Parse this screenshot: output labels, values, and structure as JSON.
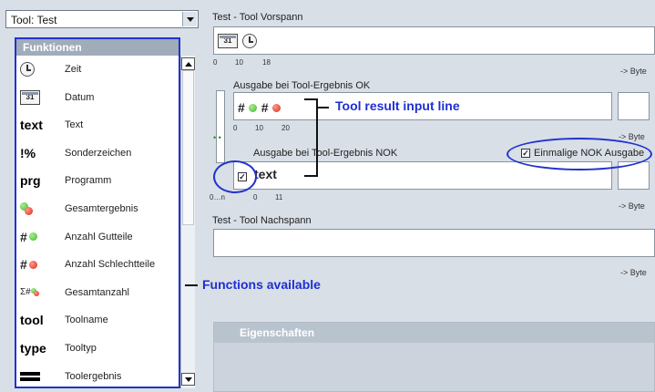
{
  "toolSelect": {
    "value": "Tool: Test"
  },
  "functions": {
    "header": "Funktionen",
    "items": [
      {
        "icon": "clock-icon",
        "glyph": "",
        "label": "Zeit"
      },
      {
        "icon": "calendar-icon",
        "glyph": "31",
        "label": "Datum"
      },
      {
        "icon": "text-icon",
        "glyph": "text",
        "label": "Text"
      },
      {
        "icon": "special-chars-icon",
        "glyph": "!%",
        "label": "Sonderzeichen"
      },
      {
        "icon": "program-icon",
        "glyph": "prg",
        "label": "Programm"
      },
      {
        "icon": "overall-result-icon",
        "glyph": "",
        "label": "Gesamtergebnis"
      },
      {
        "icon": "good-count-icon",
        "glyph": "#",
        "label": "Anzahl Gutteile"
      },
      {
        "icon": "bad-count-icon",
        "glyph": "#",
        "label": "Anzahl Schlechtteile"
      },
      {
        "icon": "total-count-icon",
        "glyph": "Σ#",
        "label": "Gesamtanzahl"
      },
      {
        "icon": "tool-name-icon",
        "glyph": "tool",
        "label": "Toolname"
      },
      {
        "icon": "tool-type-icon",
        "glyph": "type",
        "label": "Tooltyp"
      },
      {
        "icon": "tool-result-icon",
        "glyph": "",
        "label": "Toolergebnis"
      }
    ]
  },
  "preamble": {
    "label": "Test - Tool Vorspann",
    "calendar": "31",
    "ticks": [
      "0",
      "10",
      "18"
    ],
    "unit": "-> Byte"
  },
  "outputOk": {
    "label": "Ausgabe bei Tool-Ergebnis OK",
    "ticks": [
      "0",
      "10",
      "20"
    ],
    "unit": "-> Byte"
  },
  "outputNok": {
    "label": "Ausgabe bei Tool-Ergebnis NOK",
    "value": "text",
    "ticks": [
      "0",
      "11"
    ],
    "range": "0…n",
    "unit": "-> Byte",
    "checkbox": {
      "label": "Einmalige NOK Ausgabe",
      "checked": true
    }
  },
  "postamble": {
    "label": "Test - Tool Nachspann",
    "unit": "-> Byte"
  },
  "properties": {
    "header": "Eigenschaften"
  },
  "callouts": {
    "toolResult": "Tool result input line",
    "functions": "Functions available"
  },
  "colors": {
    "panel": "#d9dfe7",
    "callout": "#1f2fd1",
    "header": "#a0acba",
    "ok": "#3fb52a",
    "nok": "#d9261a"
  }
}
